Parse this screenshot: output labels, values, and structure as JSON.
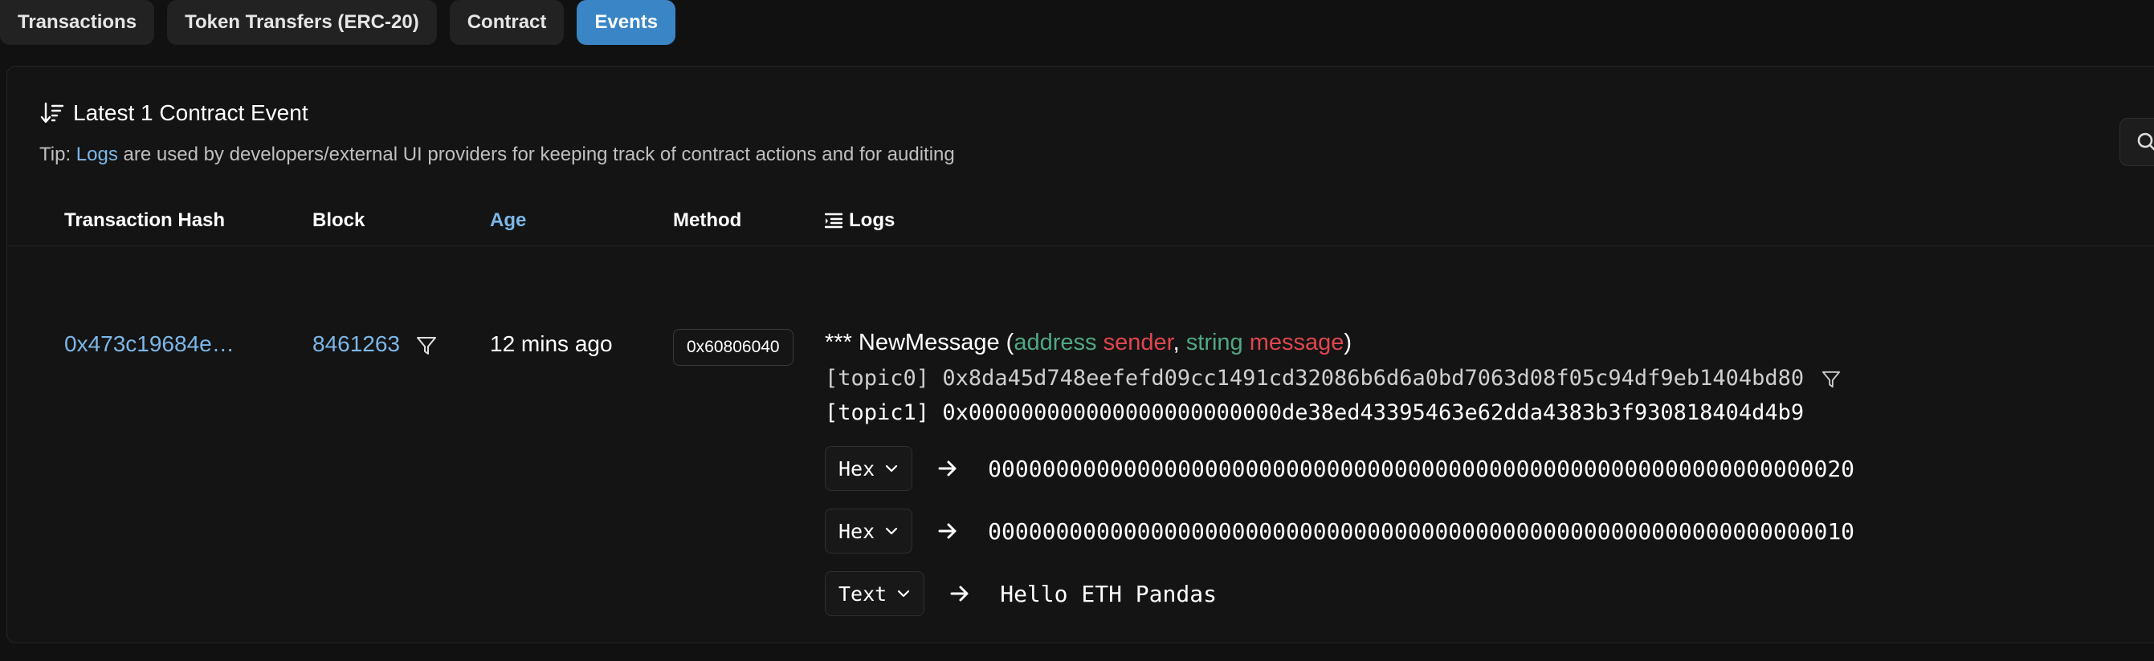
{
  "tabs": [
    {
      "label": "Transactions",
      "active": false
    },
    {
      "label": "Token Transfers (ERC-20)",
      "active": false
    },
    {
      "label": "Contract",
      "active": false
    },
    {
      "label": "Events",
      "active": true
    }
  ],
  "card": {
    "title": "Latest 1 Contract Event",
    "tip_prefix": "Tip:",
    "tip_link": "Logs",
    "tip_suffix": "are used by developers/external UI providers for keeping track of contract actions and for auditing"
  },
  "table": {
    "headers": {
      "tx_hash": "Transaction Hash",
      "block": "Block",
      "age": "Age",
      "method": "Method",
      "logs": "Logs"
    },
    "row": {
      "tx_hash": "0x473c19684e…",
      "block": "8461263",
      "age": "12 mins ago",
      "method": "0x60806040",
      "event": {
        "prefix": "*** NewMessage (",
        "param1_type": "address",
        "param1_name": "sender",
        "sep": ", ",
        "param2_type": "string",
        "param2_name": "message",
        "suffix": ")"
      },
      "topics": [
        {
          "label": "[topic0]",
          "value": "0x8da45d748eefefd09cc1491cd32086b6d6a0bd7063d08f05c94df9eb1404bd80"
        },
        {
          "label": "[topic1]",
          "value": "0x000000000000000000000000de38ed43395463e62dda4383b3f930818404d4b9"
        }
      ],
      "data": [
        {
          "format": "Hex",
          "value": "0000000000000000000000000000000000000000000000000000000000000020"
        },
        {
          "format": "Hex",
          "value": "0000000000000000000000000000000000000000000000000000000000000010"
        },
        {
          "format": "Text",
          "value": "Hello ETH Pandas"
        }
      ]
    }
  },
  "icons": {
    "sort": "sort-descending-icon",
    "search": "search-icon",
    "filter": "filter-icon",
    "logs": "list-indent-icon",
    "chevron": "chevron-down-icon",
    "arrow": "arrow-right-icon"
  },
  "colors": {
    "accent": "#3a85c6",
    "link": "#7cb7e8",
    "param_type": "#4fa883",
    "param_name": "#e0464f"
  }
}
